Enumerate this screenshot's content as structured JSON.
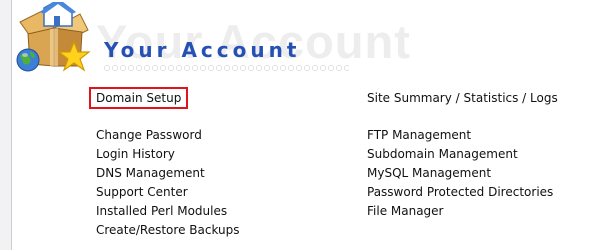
{
  "header": {
    "watermark_text": "Your Account",
    "title": "Your Account",
    "logo_icon": "package-box-globe-star-icon"
  },
  "left_column": [
    {
      "label": "Domain Setup",
      "highlighted": true
    },
    {
      "label": "Change Password"
    },
    {
      "label": "Login History"
    },
    {
      "label": "DNS Management"
    },
    {
      "label": "Support Center"
    },
    {
      "label": "Installed Perl Modules"
    },
    {
      "label": "Create/Restore Backups"
    }
  ],
  "right_column": [
    {
      "label": "Site Summary / Statistics / Logs"
    },
    {
      "label": "FTP Management"
    },
    {
      "label": "Subdomain Management"
    },
    {
      "label": "MySQL Management"
    },
    {
      "label": "Password Protected Directories"
    },
    {
      "label": "File Manager"
    }
  ],
  "colors": {
    "title": "#2551b5",
    "highlight_border": "#e0141c",
    "watermark": "#ededed"
  }
}
